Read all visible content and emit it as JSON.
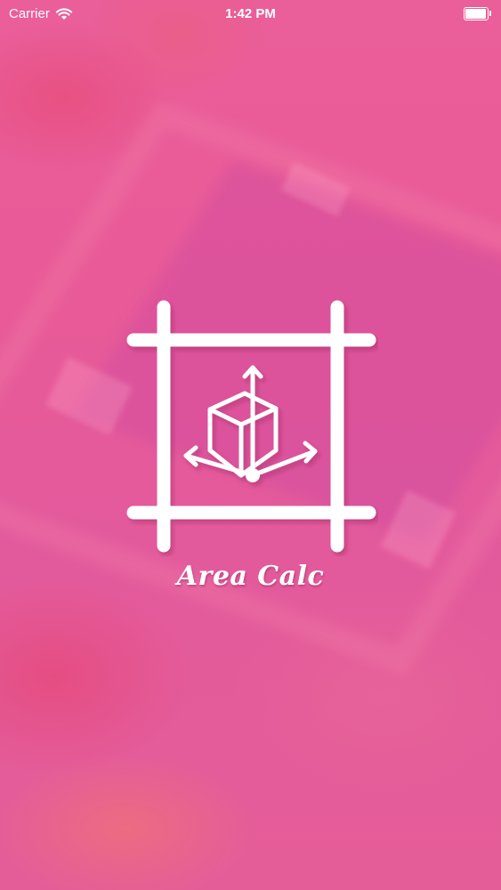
{
  "status_bar": {
    "carrier": "Carrier",
    "time": "1:42 PM",
    "battery_level": 1.0
  },
  "splash": {
    "title": "Area Calc",
    "logo_icon": "area-measure-cube-icon"
  },
  "colors": {
    "background": "#e85a98",
    "foreground": "#ffffff"
  }
}
